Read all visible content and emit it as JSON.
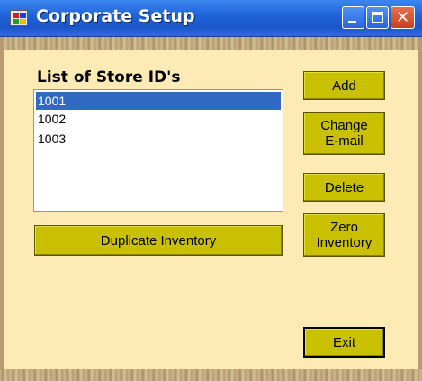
{
  "window": {
    "title": "Corporate Setup",
    "app_icon": "corporate-setup-app-icon",
    "controls": {
      "minimize_icon": "minimize-icon",
      "maximize_icon": "maximize-icon",
      "close_glyph": "✕"
    }
  },
  "store_list": {
    "label": "List of Store ID's",
    "items": [
      {
        "label": "1001",
        "selected": true
      },
      {
        "label": "1002",
        "selected": false
      },
      {
        "label": "1003",
        "selected": false
      }
    ]
  },
  "buttons": {
    "add": "Add",
    "change_email": "Change\nE-mail",
    "delete": "Delete",
    "zero_inventory": "Zero\nInventory",
    "duplicate_inventory": "Duplicate Inventory",
    "exit": "Exit"
  },
  "colors": {
    "window_background": "#fdeab4",
    "button_face": "#c8c000",
    "selection": "#316ac5",
    "titlebar": "#1f62d8"
  }
}
